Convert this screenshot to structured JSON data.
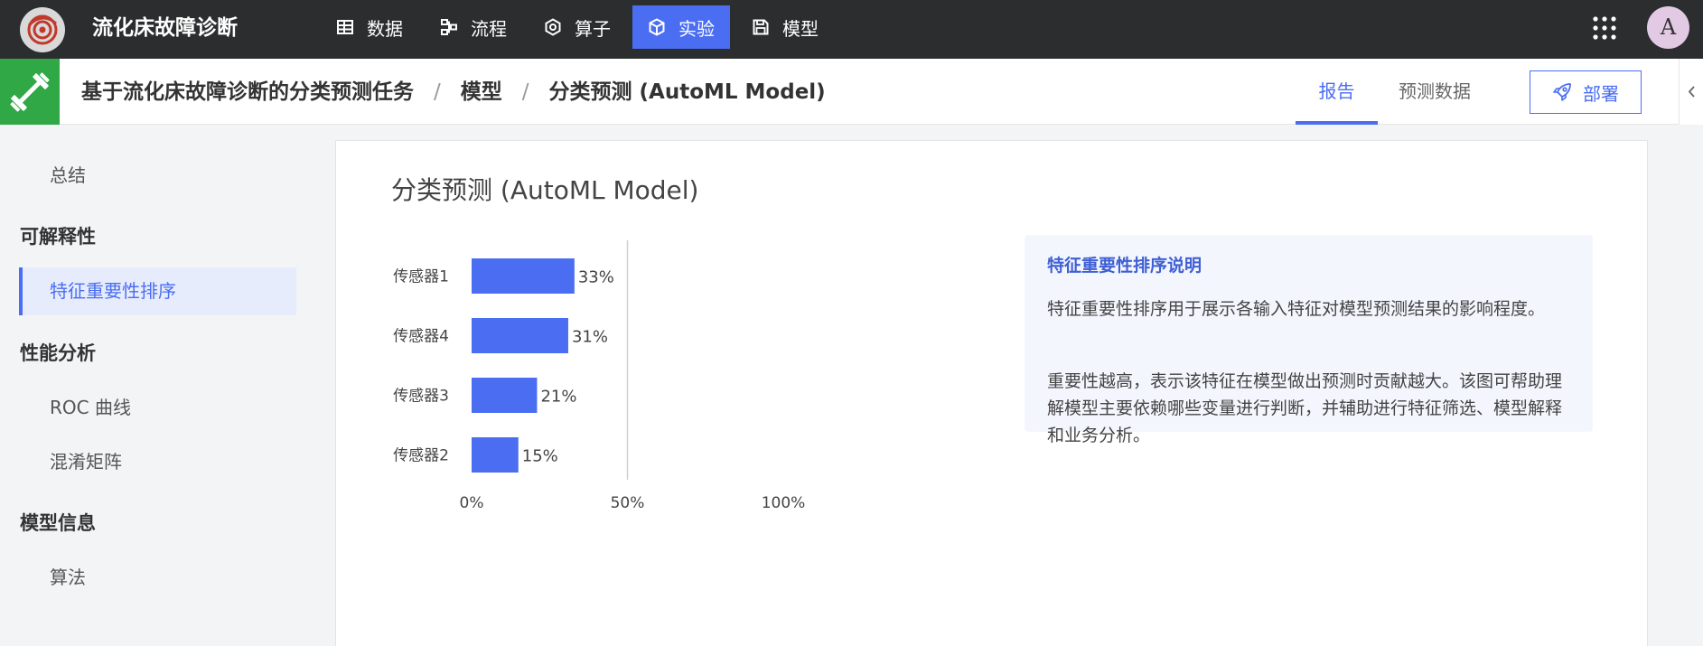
{
  "app": {
    "title": "流化床故障诊断"
  },
  "nav": [
    {
      "label": "数据",
      "icon": "table-icon"
    },
    {
      "label": "流程",
      "icon": "flow-icon"
    },
    {
      "label": "算子",
      "icon": "hexagon-icon"
    },
    {
      "label": "实验",
      "icon": "cube-icon",
      "active": true
    },
    {
      "label": "模型",
      "icon": "save-icon"
    }
  ],
  "user": {
    "avatar_letter": "A"
  },
  "breadcrumb": {
    "project": "基于流化床故障诊断的分类预测任务",
    "section": "模型",
    "current": "分类预测 (AutoML Model)",
    "separator": "/"
  },
  "tabs": {
    "report": "报告",
    "prediction_data": "预测数据"
  },
  "deploy": {
    "label": "部署"
  },
  "sidebar": {
    "summary": "总结",
    "groups": [
      {
        "title": "可解释性",
        "items": [
          "特征重要性排序"
        ]
      },
      {
        "title": "性能分析",
        "items": [
          "ROC 曲线",
          "混淆矩阵"
        ]
      },
      {
        "title": "模型信息",
        "items": [
          "算法"
        ]
      }
    ],
    "active_item": "特征重要性排序"
  },
  "card": {
    "title": "分类预测 (AutoML Model)"
  },
  "chart_data": {
    "type": "bar",
    "orientation": "horizontal",
    "categories": [
      "传感器1",
      "传感器4",
      "传感器3",
      "传感器2"
    ],
    "values": [
      33,
      31,
      21,
      15
    ],
    "value_labels": [
      "33%",
      "31%",
      "21%",
      "15%"
    ],
    "xlim": [
      0,
      100
    ],
    "xticks": [
      "0%",
      "50%",
      "100%"
    ],
    "color": "#4a6df2",
    "title": "",
    "xlabel": "",
    "ylabel": ""
  },
  "info": {
    "title": "特征重要性排序说明",
    "p1": "特征重要性排序用于展示各输入特征对模型预测结果的影响程度。",
    "p2": "重要性越高，表示该特征在模型做出预测时贡献越大。该图可帮助理解模型主要依赖哪些变量进行判断，并辅助进行特征筛选、模型解释和业务分析。"
  },
  "colors": {
    "accent": "#4a6df2",
    "topbar": "#2b2d2e",
    "project_badge": "#2fa845"
  }
}
